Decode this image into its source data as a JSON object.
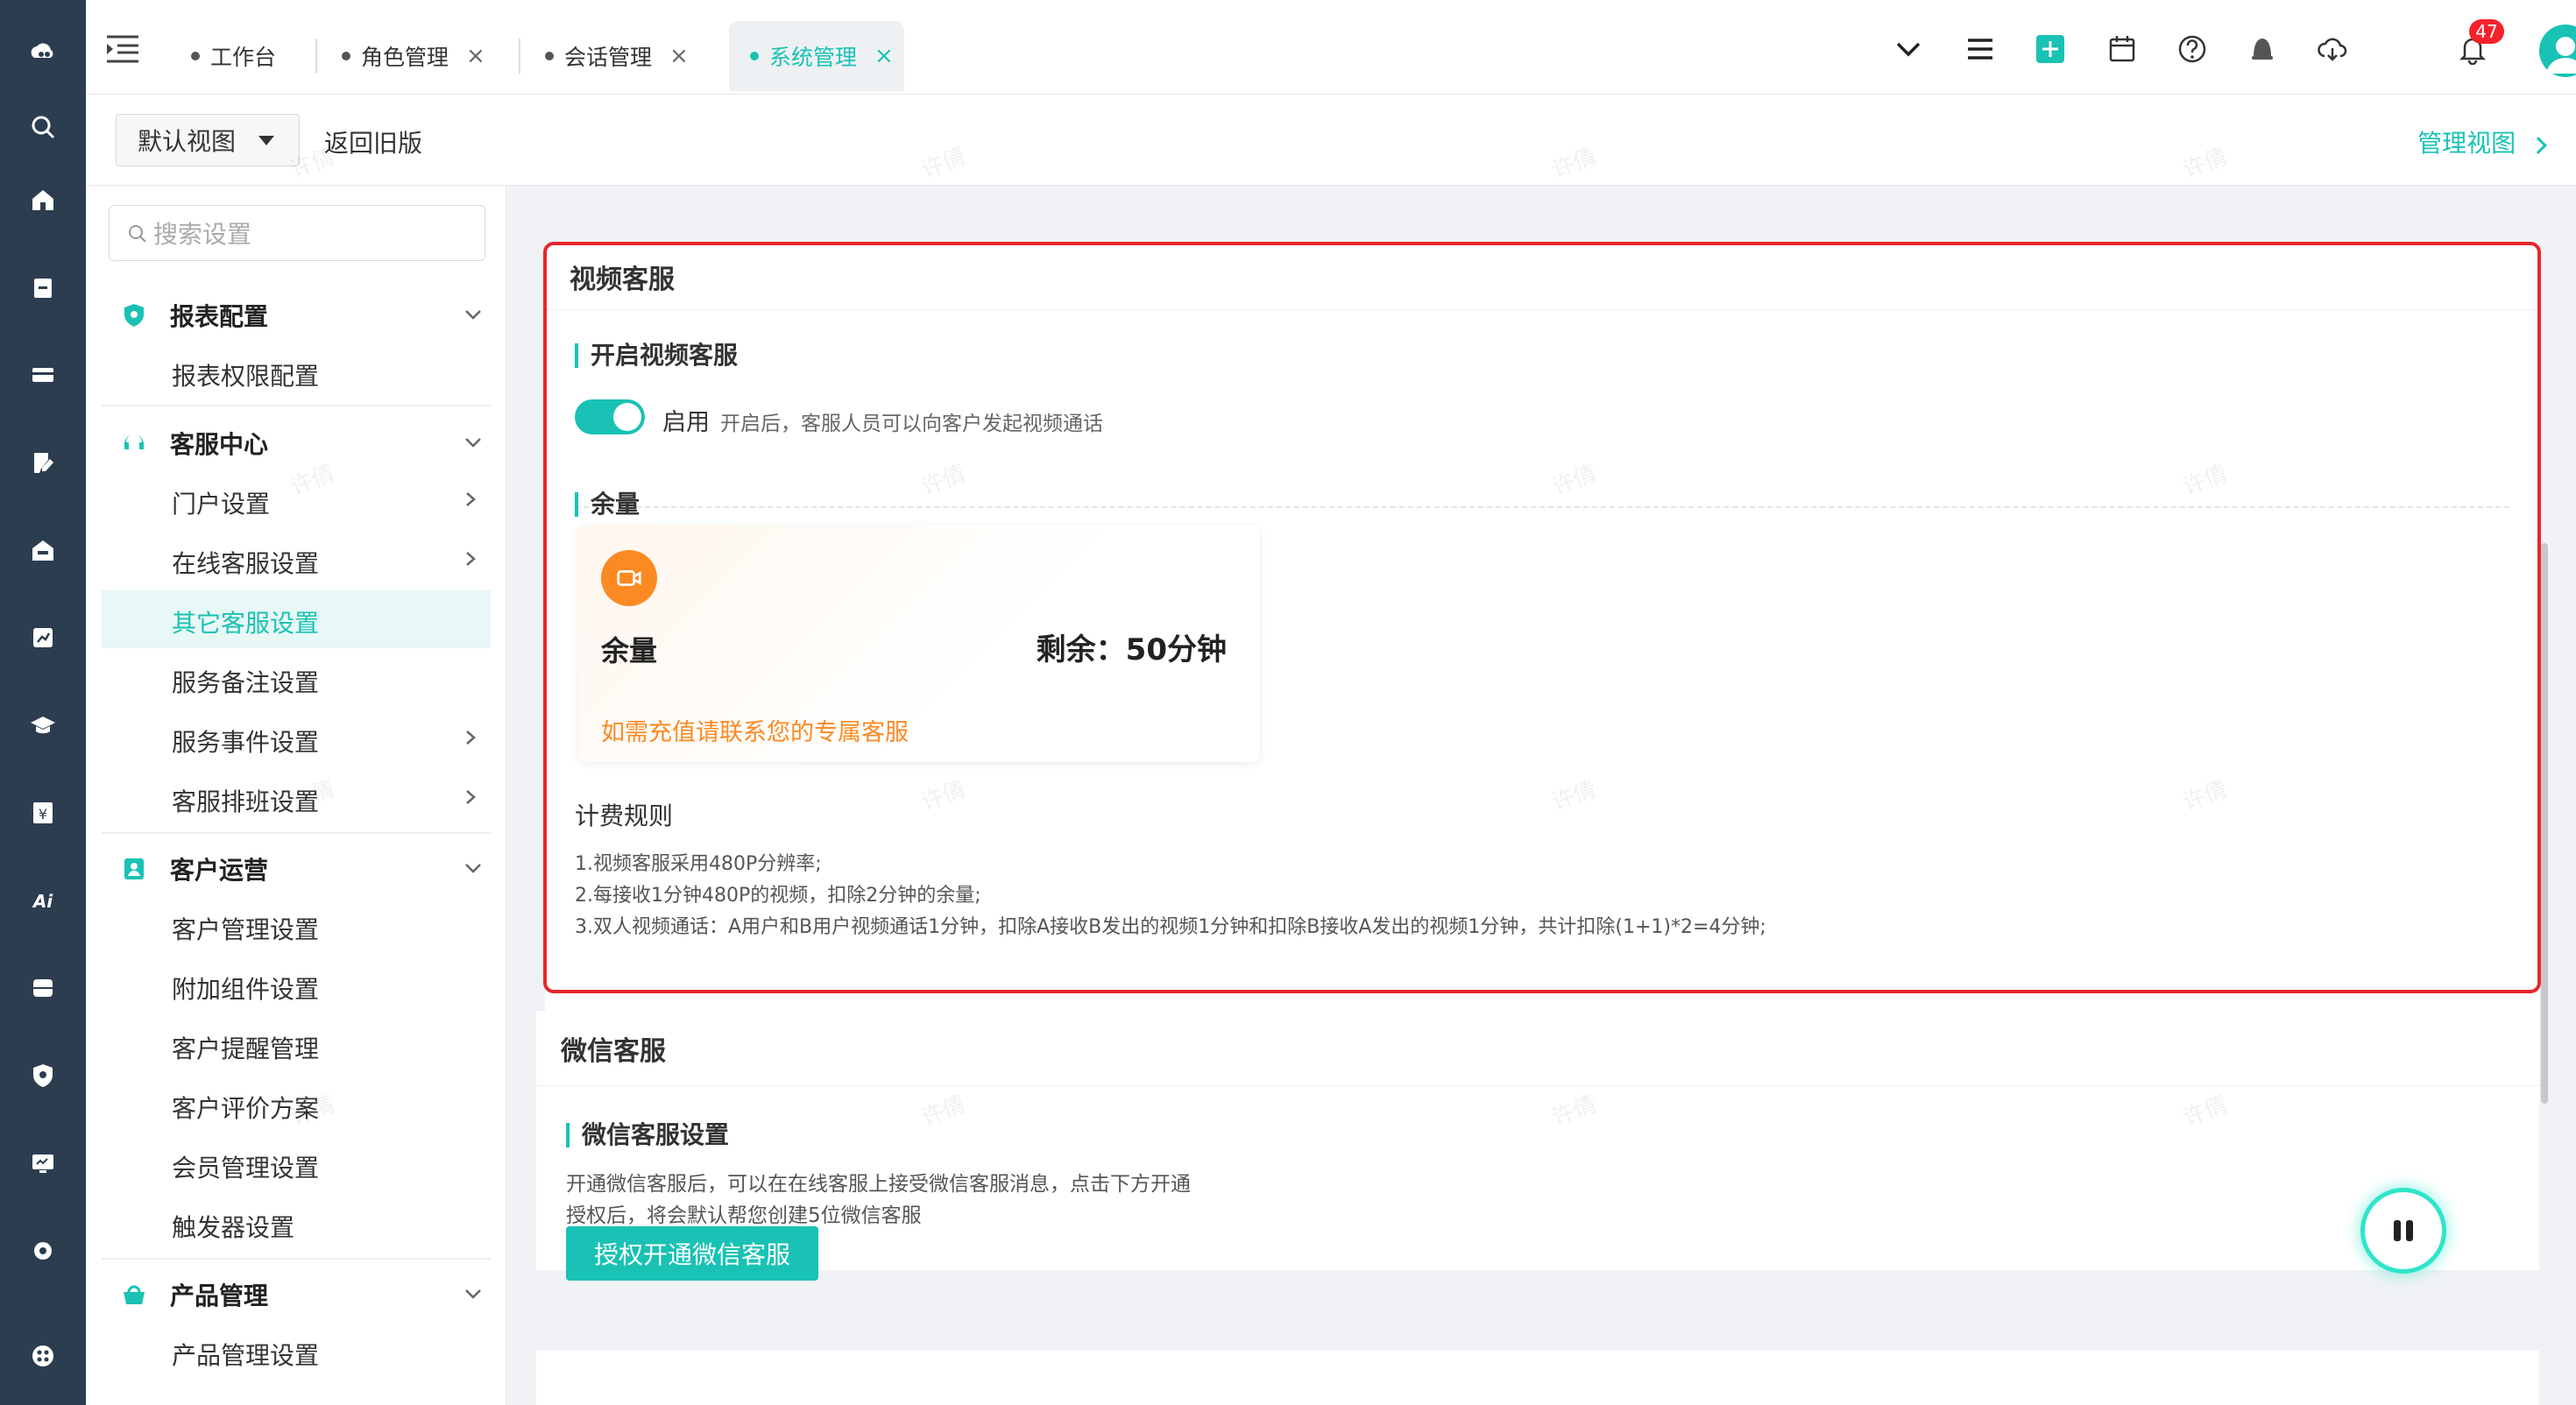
{
  "tabs": [
    {
      "label": "工作台",
      "closable": false,
      "active": false
    },
    {
      "label": "角色管理",
      "closable": true,
      "active": false
    },
    {
      "label": "会话管理",
      "closable": true,
      "active": false
    },
    {
      "label": "系统管理",
      "closable": true,
      "active": true
    }
  ],
  "tab_close_glyph": "×",
  "notification_count": "47",
  "subheader": {
    "view_select": "默认视图",
    "back_old": "返回旧版",
    "manage_view": "管理视图"
  },
  "nav": {
    "search_placeholder": "搜索设置",
    "groups": [
      {
        "label": "报表配置",
        "icon": "shield-icon",
        "items": [
          {
            "label": "报表权限配置",
            "chevron": false
          }
        ]
      },
      {
        "label": "客服中心",
        "icon": "headset-icon",
        "items": [
          {
            "label": "门户设置",
            "chevron": true
          },
          {
            "label": "在线客服设置",
            "chevron": true
          },
          {
            "label": "其它客服设置",
            "chevron": false,
            "active": true
          },
          {
            "label": "服务备注设置",
            "chevron": false
          },
          {
            "label": "服务事件设置",
            "chevron": true
          },
          {
            "label": "客服排班设置",
            "chevron": true
          }
        ]
      },
      {
        "label": "客户运营",
        "icon": "contact-icon",
        "items": [
          {
            "label": "客户管理设置",
            "chevron": false
          },
          {
            "label": "附加组件设置",
            "chevron": false
          },
          {
            "label": "客户提醒管理",
            "chevron": false
          },
          {
            "label": "客户评价方案",
            "chevron": false
          },
          {
            "label": "会员管理设置",
            "chevron": false
          },
          {
            "label": "触发器设置",
            "chevron": false
          }
        ]
      },
      {
        "label": "产品管理",
        "icon": "product-icon",
        "items": [
          {
            "label": "产品管理设置",
            "chevron": false
          }
        ]
      }
    ]
  },
  "video_service": {
    "title": "视频客服",
    "enable_section_title": "开启视频客服",
    "toggle_on": true,
    "toggle_label": "启用",
    "toggle_desc": "开启后，客服人员可以向客户发起视频通话",
    "quota_section_title": "余量",
    "quota_card": {
      "label": "余量",
      "remaining": "剩余：50分钟",
      "tip": "如需充值请联系您的专属客服"
    },
    "rules_title": "计费规则",
    "rules": [
      "1.视频客服采用480P分辨率;",
      "2.每接收1分钟480P的视频，扣除2分钟的余量;",
      "3.双人视频通话：A用户和B用户视频通话1分钟，扣除A接收B发出的视频1分钟和扣除B接收A发出的视频1分钟，共计扣除(1+1)*2=4分钟;"
    ]
  },
  "wechat_service": {
    "title": "微信客服",
    "section_title": "微信客服设置",
    "desc_line1": "开通微信客服后，可以在在线客服上接受微信客服消息，点击下方开通",
    "desc_line2": "授权后，将会默认帮您创建5位微信客服",
    "button": "授权开通微信客服"
  },
  "watermark": "许倩",
  "colors": {
    "accent": "#19c2b4",
    "rail": "#2b3d4f",
    "highlight": "#e8262d",
    "quota_orange": "#fb8a22",
    "badge": "#f5222d"
  }
}
